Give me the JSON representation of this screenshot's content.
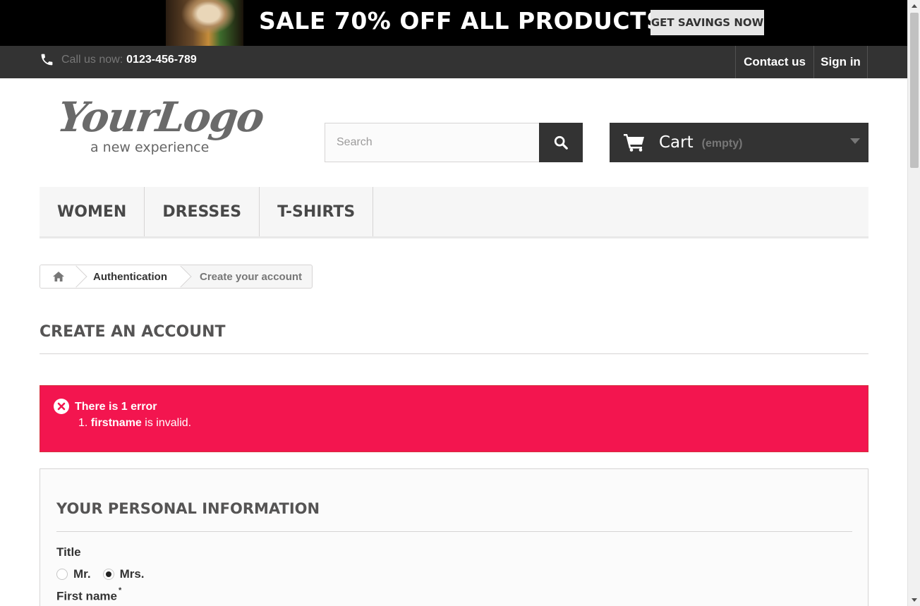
{
  "banner": {
    "title": "SALE 70% OFF ALL PRODUCTS",
    "cta": "GET SAVINGS NOW"
  },
  "nav": {
    "call_prefix": "Call us now:",
    "phone": "0123-456-789",
    "contact": "Contact us",
    "signin": "Sign in"
  },
  "logo": {
    "word": "YourLogo",
    "tagline": "a new experience"
  },
  "search": {
    "placeholder": "Search",
    "value": ""
  },
  "cart": {
    "label": "Cart",
    "status": "(empty)"
  },
  "menu": [
    "WOMEN",
    "DRESSES",
    "T-SHIRTS"
  ],
  "breadcrumb": {
    "parent": "Authentication",
    "current": "Create your account"
  },
  "page_title": "CREATE AN ACCOUNT",
  "error": {
    "heading": "There is 1 error",
    "number": "1.",
    "field": "firstname",
    "message": "is invalid."
  },
  "form": {
    "section_title": "YOUR PERSONAL INFORMATION",
    "title_label": "Title",
    "options": [
      {
        "label": "Mr.",
        "checked": false
      },
      {
        "label": "Mrs.",
        "checked": true
      }
    ],
    "firstname_label": "First name",
    "required_mark": "*"
  },
  "colors": {
    "error_bg": "#f3154f",
    "dark": "#333333",
    "banner_bg": "#000000"
  },
  "icons": [
    "phone-icon",
    "search-icon",
    "cart-icon",
    "chevron-down-icon",
    "home-icon",
    "error-icon"
  ]
}
